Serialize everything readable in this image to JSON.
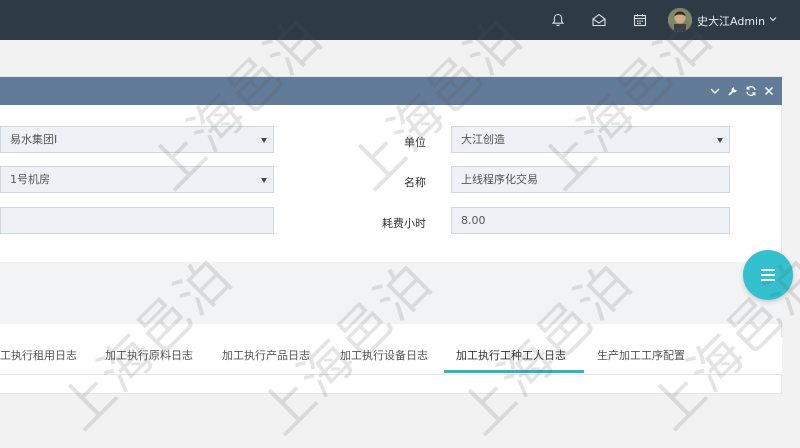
{
  "topbar": {
    "icons": [
      "bell-icon",
      "mail-open-icon",
      "calendar-icon"
    ],
    "username": "史大江Admin"
  },
  "panel": {
    "tools": [
      "chevron-down-icon",
      "wrench-icon",
      "refresh-icon",
      "close-icon"
    ]
  },
  "form": {
    "group_value": "易水集团I",
    "room_value": "1号机房",
    "third_value": "",
    "unit_label": "单位",
    "unit_value": "大江创造",
    "name_label": "名称",
    "name_value": "上线程序化交易",
    "hours_label": "耗费小时",
    "hours_value": "8.00"
  },
  "tabs": [
    {
      "label": "工执行租用日志"
    },
    {
      "label": "加工执行原料日志"
    },
    {
      "label": "加工执行产品日志"
    },
    {
      "label": "加工执行设备日志"
    },
    {
      "label": "加工执行工种工人日志",
      "active": true
    },
    {
      "label": "生产加工工序配置"
    }
  ],
  "watermark": "上海邑泊",
  "colors": {
    "topbar": "#2e3a46",
    "panel_header": "#627b98",
    "accent": "#2fb2c4",
    "fab": "#33c1cf"
  }
}
